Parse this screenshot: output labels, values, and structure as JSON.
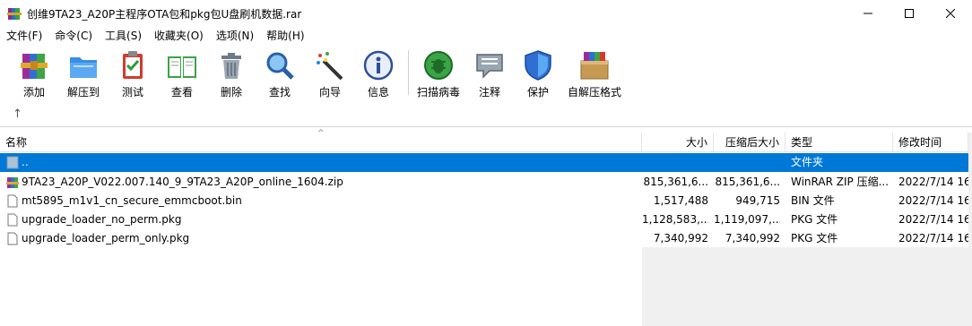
{
  "window": {
    "title": "创维9TA23_A20P主程序OTA包和pkg包U盘刷机数据.rar",
    "app_icon": "winrar-books-icon"
  },
  "menu": {
    "items": [
      "文件(F)",
      "命令(C)",
      "工具(S)",
      "收藏夹(O)",
      "选项(N)",
      "帮助(H)"
    ]
  },
  "toolbar": {
    "buttons": [
      {
        "label": "添加",
        "icon": "add-archive-icon"
      },
      {
        "label": "解压到",
        "icon": "extract-folder-icon"
      },
      {
        "label": "测试",
        "icon": "test-clipboard-icon"
      },
      {
        "label": "查看",
        "icon": "view-book-icon"
      },
      {
        "label": "删除",
        "icon": "trash-icon"
      },
      {
        "label": "查找",
        "icon": "magnifier-icon"
      },
      {
        "label": "向导",
        "icon": "wizard-wand-icon"
      },
      {
        "label": "信息",
        "icon": "info-icon"
      },
      {
        "label": "扫描病毒",
        "icon": "virus-scan-icon"
      },
      {
        "label": "注释",
        "icon": "comment-icon"
      },
      {
        "label": "保护",
        "icon": "shield-icon"
      },
      {
        "label": "自解压格式",
        "icon": "sfx-box-icon"
      }
    ]
  },
  "pathbar": {
    "up_icon": "up-arrow-icon"
  },
  "columns": {
    "name": "名称",
    "size": "大小",
    "packed": "压缩后大小",
    "type": "类型",
    "modified": "修改时间"
  },
  "files": [
    {
      "name": "..",
      "size": "",
      "packed": "",
      "type": "文件夹",
      "modified": "",
      "icon": "parent-folder-icon",
      "selected": true
    },
    {
      "name": "9TA23_A20P_V022.007.140_9_9TA23_A20P_online_1604.zip",
      "size": "815,361,6...",
      "packed": "815,361,6...",
      "type": "WinRAR ZIP 压缩...",
      "modified": "2022/7/14 16",
      "icon": "zip-archive-icon",
      "selected": false
    },
    {
      "name": "mt5895_m1v1_cn_secure_emmcboot.bin",
      "size": "1,517,488",
      "packed": "949,715",
      "type": "BIN 文件",
      "modified": "2022/7/14 16",
      "icon": "file-icon",
      "selected": false
    },
    {
      "name": "upgrade_loader_no_perm.pkg",
      "size": "1,128,583,...",
      "packed": "1,119,097,...",
      "type": "PKG 文件",
      "modified": "2022/7/14 16",
      "icon": "file-icon",
      "selected": false
    },
    {
      "name": "upgrade_loader_perm_only.pkg",
      "size": "7,340,992",
      "packed": "7,340,992",
      "type": "PKG 文件",
      "modified": "2022/7/14 16",
      "icon": "file-icon",
      "selected": false
    }
  ],
  "colors": {
    "selection": "#0078d7",
    "status_area": "#f0f0f0"
  }
}
